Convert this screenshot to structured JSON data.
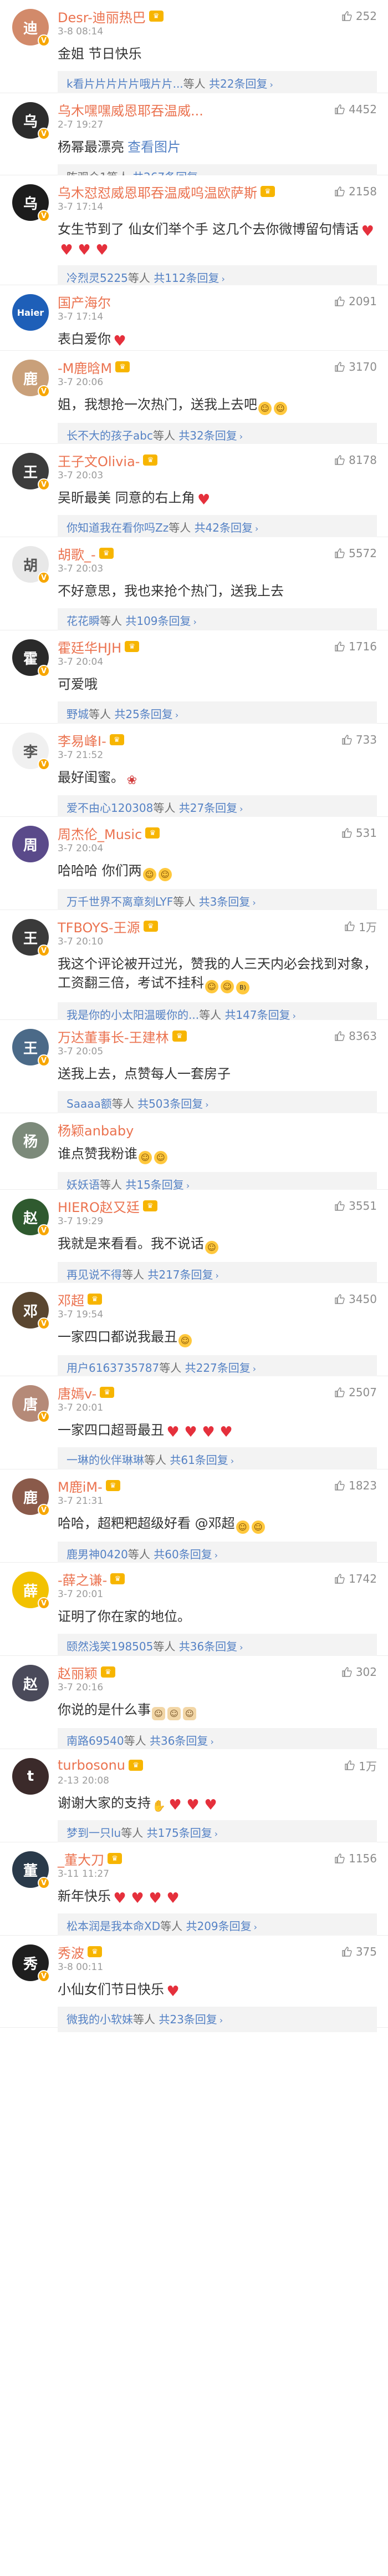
{
  "comments": [
    {
      "user": "Desr-迪丽热巴",
      "crown": true,
      "verified": true,
      "time": "3-8 08:14",
      "likes": "252",
      "text": "金姐 节日快乐",
      "emoji": [],
      "reply": {
        "user": "k看片片片片片哦片片...",
        "rest": "等人 ",
        "count": "共22条回复"
      },
      "avatar_color": "#d28a6a",
      "avatar_char": "迪",
      "height": 168
    },
    {
      "user": "乌木嘿嘿威恩耶吞温威...",
      "crown": false,
      "verified": true,
      "time": "2-7 19:27",
      "likes": "4452",
      "text": "杨幂最漂亮",
      "emoji": [],
      "reply": {
        "user": "",
        "rest": "陈观众1等人 ",
        "count": "共267条回复"
      },
      "avatar_color": "#2c2c2c",
      "avatar_char": "乌",
      "height": 148,
      "text_link": "查看图片"
    },
    {
      "user": "乌木怼怼威恩耶吞温威呜温欧萨斯",
      "crown": true,
      "verified": true,
      "time": "3-7 17:14",
      "likes": "2158",
      "text": "女生节到了 仙女们举个手 这几个去你微博留句情话",
      "emoji": [
        "heart",
        "heart",
        "heart",
        "heart"
      ],
      "reply": {
        "user": "冷烈灵5225",
        "rest": "等人 ",
        "count": "共112条回复"
      },
      "avatar_color": "#1c1c1c",
      "avatar_char": "乌",
      "height": 198
    },
    {
      "user": "国产海尔",
      "crown": false,
      "verified": false,
      "time": "3-7 17:14",
      "likes": "2091",
      "text": "表白爱你",
      "emoji": [
        "heart"
      ],
      "reply": null,
      "avatar_color": "#1e5fb8",
      "avatar_char": "Haier",
      "height": 118
    },
    {
      "user": "-M鹿晗M",
      "crown": true,
      "verified": true,
      "time": "3-7 20:06",
      "likes": "3170",
      "text": "姐，我想抢一次热门，送我上去吧",
      "emoji": [
        "face",
        "face"
      ],
      "reply": {
        "user": "长不大的孩子abc",
        "rest": "等人 ",
        "count": "共32条回复"
      },
      "avatar_color": "#c9a07a",
      "avatar_char": "鹿",
      "height": 168
    },
    {
      "user": "王子文Olivia-",
      "crown": true,
      "verified": true,
      "time": "3-7 20:03",
      "likes": "8178",
      "text": "吴昕最美 同意的右上角",
      "emoji": [
        "heart"
      ],
      "reply": {
        "user": "你知道我在看你吗Zz",
        "rest": "等人 ",
        "count": "共42条回复"
      },
      "avatar_color": "#3c3c3c",
      "avatar_char": "王",
      "height": 168
    },
    {
      "user": "胡歌_-",
      "crown": true,
      "verified": true,
      "time": "3-7 20:03",
      "likes": "5572",
      "text": "不好意思，我也来抢个热门，送我上去",
      "emoji": [],
      "reply": {
        "user": "花花瞬",
        "rest": "等人 ",
        "count": "共109条回复"
      },
      "avatar_color": "#e8e8e8",
      "avatar_char": "胡",
      "height": 168
    },
    {
      "user": "霍廷华HJH",
      "crown": true,
      "verified": true,
      "time": "3-7 20:04",
      "likes": "1716",
      "text": "可爱哦",
      "emoji": [],
      "reply": {
        "user": "野城",
        "rest": "等人 ",
        "count": "共25条回复"
      },
      "avatar_color": "#2a2a2a",
      "avatar_char": "霍",
      "height": 168
    },
    {
      "user": "李易峰I-",
      "crown": true,
      "verified": true,
      "time": "3-7 21:52",
      "likes": "733",
      "text": "最好闺蜜。",
      "emoji": [
        "rose"
      ],
      "reply": {
        "user": "爱不由心120308",
        "rest": "等人 ",
        "count": "共27条回复"
      },
      "avatar_color": "#f0f0f0",
      "avatar_char": "李",
      "height": 168
    },
    {
      "user": "周杰伦_Music",
      "crown": true,
      "verified": false,
      "time": "3-7 20:04",
      "likes": "531",
      "text": "哈哈哈 你们两",
      "emoji": [
        "face",
        "face"
      ],
      "reply": {
        "user": "万千世界不离章刻LYF",
        "rest": "等人 ",
        "count": "共3条回复"
      },
      "avatar_color": "#5a4a8a",
      "avatar_char": "周",
      "height": 168
    },
    {
      "user": "TFBOYS-王源",
      "crown": true,
      "verified": true,
      "time": "3-7 20:10",
      "likes": "1万",
      "text": "我这个评论被开过光，赞我的人三天内必会找到对象，工资翻三倍，考试不挂科",
      "emoji": [
        "face",
        "face",
        "cool"
      ],
      "reply": {
        "user": "我是你的小太阳温暖你的...",
        "rest": "等人 ",
        "count": "共147条回复"
      },
      "avatar_color": "#3a3a3a",
      "avatar_char": "王",
      "height": 198
    },
    {
      "user": "万达董事长-王建林",
      "crown": true,
      "verified": true,
      "time": "3-7 20:05",
      "likes": "8363",
      "text": "送我上去，点赞每人一套房子",
      "emoji": [],
      "reply": {
        "user": "Saaaa额",
        "rest": "等人 ",
        "count": "共503条回复"
      },
      "avatar_color": "#4b6a88",
      "avatar_char": "王",
      "height": 168
    },
    {
      "user": "杨颖anbaby",
      "crown": false,
      "verified": false,
      "time": "",
      "likes": "",
      "text": "谁点赞我粉谁",
      "emoji": [
        "face",
        "face"
      ],
      "reply": {
        "user": "妖妖语",
        "rest": "等人 ",
        "count": "共15条回复"
      },
      "avatar_color": "#7c8a7a",
      "avatar_char": "杨",
      "height": 138
    },
    {
      "user": "HIERO赵又廷",
      "crown": true,
      "verified": true,
      "time": "3-7 19:29",
      "likes": "3551",
      "text": "我就是来看看。我不说话",
      "emoji": [
        "face"
      ],
      "reply": {
        "user": "再见说不得",
        "rest": "等人 ",
        "count": "共217条回复"
      },
      "avatar_color": "#2f5a2f",
      "avatar_char": "赵",
      "height": 168
    },
    {
      "user": "邓超",
      "crown": true,
      "verified": true,
      "time": "3-7 19:54",
      "likes": "3450",
      "text": "一家四口都说我最丑",
      "emoji": [
        "face"
      ],
      "reply": {
        "user": "用户6163735787",
        "rest": "等人 ",
        "count": "共227条回复"
      },
      "avatar_color": "#5a4630",
      "avatar_char": "邓",
      "height": 168
    },
    {
      "user": "唐嫣v-",
      "crown": true,
      "verified": true,
      "time": "3-7 20:01",
      "likes": "2507",
      "text": "一家四口超哥最丑",
      "emoji": [
        "heart",
        "heart",
        "heart",
        "heart"
      ],
      "reply": {
        "user": "一琳的伙伴琳琳",
        "rest": "等人 ",
        "count": "共61条回复"
      },
      "avatar_color": "#b58a78",
      "avatar_char": "唐",
      "height": 168
    },
    {
      "user": "M鹿iM-",
      "crown": true,
      "verified": true,
      "time": "3-7 21:31",
      "likes": "1823",
      "text": "哈哈，超粑粑超级好看 @邓超",
      "emoji": [
        "face",
        "face"
      ],
      "reply": {
        "user": "鹿男神0420",
        "rest": "等人 ",
        "count": "共60条回复"
      },
      "avatar_color": "#8a5a4a",
      "avatar_char": "鹿",
      "height": 168
    },
    {
      "user": "-薛之谦-",
      "crown": true,
      "verified": true,
      "time": "3-7 20:01",
      "likes": "1742",
      "text": "证明了你在家的地位。",
      "emoji": [],
      "reply": {
        "user": "颐然浅笑198505",
        "rest": "等人 ",
        "count": "共36条回复"
      },
      "avatar_color": "#f2c200",
      "avatar_char": "薛",
      "height": 168
    },
    {
      "user": "赵丽颖",
      "crown": true,
      "verified": false,
      "time": "3-7 20:16",
      "likes": "302",
      "text": "你说的是什么事",
      "emoji": [
        "cat",
        "cat",
        "cat"
      ],
      "reply": {
        "user": "南路69540",
        "rest": "等人 ",
        "count": "共36条回复"
      },
      "avatar_color": "#4a4a5a",
      "avatar_char": "赵",
      "height": 168
    },
    {
      "user": "turbosonu",
      "crown": true,
      "verified": false,
      "time": "2-13 20:08",
      "likes": "1万",
      "text": "谢谢大家的支持",
      "emoji": [
        "clap",
        "heart",
        "heart",
        "heart"
      ],
      "reply": {
        "user": "梦到一只lu",
        "rest": "等人 ",
        "count": "共175条回复"
      },
      "avatar_color": "#3b2a2a",
      "avatar_char": "t",
      "height": 168
    },
    {
      "user": "_董大刀",
      "crown": true,
      "verified": true,
      "time": "3-11 11:27",
      "likes": "1156",
      "text": "新年快乐",
      "emoji": [
        "heart",
        "heart",
        "heart",
        "heart"
      ],
      "reply": {
        "user": "松本润是我本命XD",
        "rest": "等人 ",
        "count": "共209条回复"
      },
      "avatar_color": "#2a3a4a",
      "avatar_char": "董",
      "height": 168
    },
    {
      "user": "秀波",
      "crown": true,
      "verified": true,
      "time": "3-8 00:11",
      "likes": "375",
      "text": "小仙女们节日快乐",
      "emoji": [
        "heart"
      ],
      "reply": {
        "user": "微我的小软妹",
        "rest": "等人 ",
        "count": "共23条回复"
      },
      "avatar_color": "#1e1e1e",
      "avatar_char": "秀",
      "height": 166
    }
  ],
  "labels": {
    "more_arrow": "›"
  }
}
